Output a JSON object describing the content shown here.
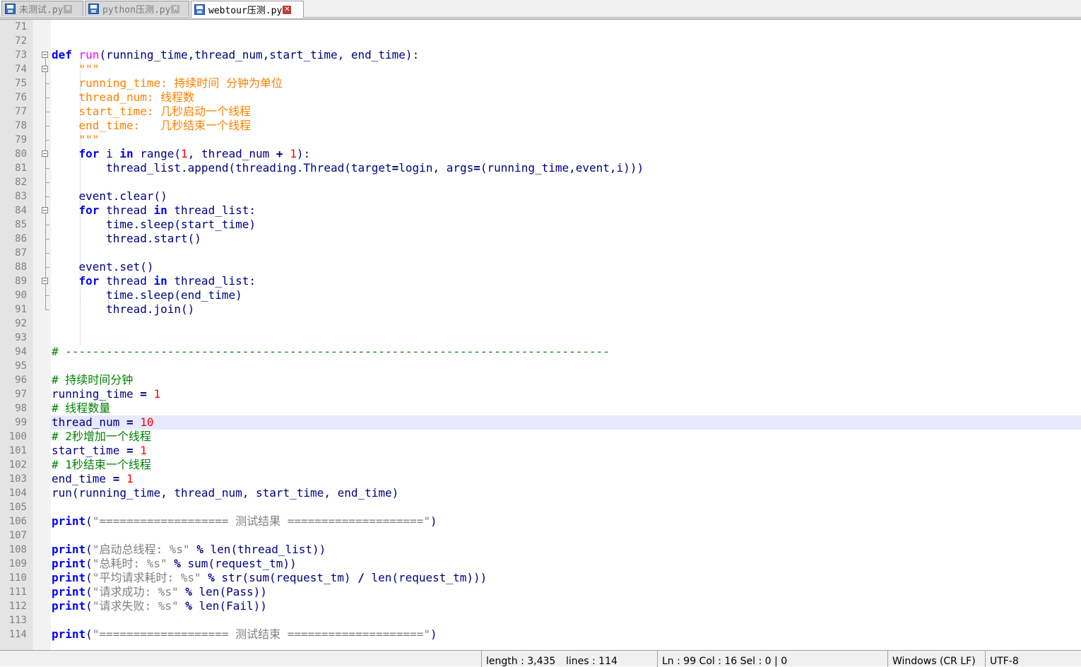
{
  "tabs": [
    {
      "label": "未测试.py",
      "active": false
    },
    {
      "label": "python压测.py",
      "active": false
    },
    {
      "label": "webtour压测.py",
      "active": true
    }
  ],
  "editor": {
    "current_line": 99,
    "lines": [
      {
        "n": "71",
        "segs": []
      },
      {
        "n": "72",
        "segs": []
      },
      {
        "n": "73",
        "segs": [
          [
            "kw",
            "def"
          ],
          [
            "p",
            " "
          ],
          [
            "fn",
            "run"
          ],
          [
            "p",
            "(running_time,thread_num,start_time, end_time):"
          ]
        ]
      },
      {
        "n": "74",
        "segs": [
          [
            "doc",
            "    \"\"\""
          ]
        ]
      },
      {
        "n": "75",
        "segs": [
          [
            "doc",
            "    running_time: 持续时间 分钟为单位"
          ]
        ]
      },
      {
        "n": "76",
        "segs": [
          [
            "doc",
            "    thread_num: 线程数"
          ]
        ]
      },
      {
        "n": "77",
        "segs": [
          [
            "doc",
            "    start_time: 几秒启动一个线程"
          ]
        ]
      },
      {
        "n": "78",
        "segs": [
          [
            "doc",
            "    end_time:   几秒结束一个线程"
          ]
        ]
      },
      {
        "n": "79",
        "segs": [
          [
            "doc",
            "    \"\"\""
          ]
        ]
      },
      {
        "n": "80",
        "segs": [
          [
            "p",
            "    "
          ],
          [
            "kw",
            "for"
          ],
          [
            "p",
            " i "
          ],
          [
            "kw",
            "in"
          ],
          [
            "p",
            " range("
          ],
          [
            "num",
            "1"
          ],
          [
            "p",
            ", thread_num "
          ],
          [
            "op",
            "+"
          ],
          [
            "p",
            " "
          ],
          [
            "num",
            "1"
          ],
          [
            "p",
            "):"
          ]
        ]
      },
      {
        "n": "81",
        "segs": [
          [
            "p",
            "        thread_list.append(threading.Thread(target"
          ],
          [
            "op",
            "="
          ],
          [
            "p",
            "login, args"
          ],
          [
            "op",
            "="
          ],
          [
            "p",
            "(running_time,event,i)))"
          ]
        ]
      },
      {
        "n": "82",
        "segs": []
      },
      {
        "n": "83",
        "segs": [
          [
            "p",
            "    event.clear()"
          ]
        ]
      },
      {
        "n": "84",
        "segs": [
          [
            "p",
            "    "
          ],
          [
            "kw",
            "for"
          ],
          [
            "p",
            " thread "
          ],
          [
            "kw",
            "in"
          ],
          [
            "p",
            " thread_list:"
          ]
        ]
      },
      {
        "n": "85",
        "segs": [
          [
            "p",
            "        time.sleep(start_time)"
          ]
        ]
      },
      {
        "n": "86",
        "segs": [
          [
            "p",
            "        thread.start()"
          ]
        ]
      },
      {
        "n": "87",
        "segs": []
      },
      {
        "n": "88",
        "segs": [
          [
            "p",
            "    event.set()"
          ]
        ]
      },
      {
        "n": "89",
        "segs": [
          [
            "p",
            "    "
          ],
          [
            "kw",
            "for"
          ],
          [
            "p",
            " thread "
          ],
          [
            "kw",
            "in"
          ],
          [
            "p",
            " thread_list:"
          ]
        ]
      },
      {
        "n": "90",
        "segs": [
          [
            "p",
            "        time.sleep(end_time)"
          ]
        ]
      },
      {
        "n": "91",
        "segs": [
          [
            "p",
            "        thread.join()"
          ]
        ]
      },
      {
        "n": "92",
        "segs": []
      },
      {
        "n": "93",
        "segs": []
      },
      {
        "n": "94",
        "segs": [
          [
            "cmt",
            "# --------------------------------------------------------------------------------"
          ]
        ]
      },
      {
        "n": "95",
        "segs": []
      },
      {
        "n": "96",
        "segs": [
          [
            "cmt",
            "# 持续时间分钟"
          ]
        ]
      },
      {
        "n": "97",
        "segs": [
          [
            "p",
            "running_time "
          ],
          [
            "op",
            "="
          ],
          [
            "p",
            " "
          ],
          [
            "num",
            "1"
          ]
        ]
      },
      {
        "n": "98",
        "segs": [
          [
            "cmt",
            "# 线程数量"
          ]
        ]
      },
      {
        "n": "99",
        "segs": [
          [
            "p",
            "thread_num "
          ],
          [
            "op",
            "="
          ],
          [
            "p",
            " "
          ],
          [
            "num",
            "10"
          ]
        ]
      },
      {
        "n": "100",
        "segs": [
          [
            "cmt",
            "# 2秒增加一个线程"
          ]
        ]
      },
      {
        "n": "101",
        "segs": [
          [
            "p",
            "start_time "
          ],
          [
            "op",
            "="
          ],
          [
            "p",
            " "
          ],
          [
            "num",
            "1"
          ]
        ]
      },
      {
        "n": "102",
        "segs": [
          [
            "cmt",
            "# 1秒结束一个线程"
          ]
        ]
      },
      {
        "n": "103",
        "segs": [
          [
            "p",
            "end_time "
          ],
          [
            "op",
            "="
          ],
          [
            "p",
            " "
          ],
          [
            "num",
            "1"
          ]
        ]
      },
      {
        "n": "104",
        "segs": [
          [
            "p",
            "run(running_time, thread_num, start_time, end_time)"
          ]
        ]
      },
      {
        "n": "105",
        "segs": []
      },
      {
        "n": "106",
        "segs": [
          [
            "kw",
            "print"
          ],
          [
            "p",
            "("
          ],
          [
            "str",
            "\"=================== 测试结果 ====================\""
          ],
          [
            "p",
            ")"
          ]
        ]
      },
      {
        "n": "107",
        "segs": []
      },
      {
        "n": "108",
        "segs": [
          [
            "kw",
            "print"
          ],
          [
            "p",
            "("
          ],
          [
            "str",
            "\"启动总线程: %s\""
          ],
          [
            "p",
            " "
          ],
          [
            "op",
            "%"
          ],
          [
            "p",
            " len(thread_list))"
          ]
        ]
      },
      {
        "n": "109",
        "segs": [
          [
            "kw",
            "print"
          ],
          [
            "p",
            "("
          ],
          [
            "str",
            "\"总耗时: %s\""
          ],
          [
            "p",
            " "
          ],
          [
            "op",
            "%"
          ],
          [
            "p",
            " sum(request_tm))"
          ]
        ]
      },
      {
        "n": "110",
        "segs": [
          [
            "kw",
            "print"
          ],
          [
            "p",
            "("
          ],
          [
            "str",
            "\"平均请求耗时: %s\""
          ],
          [
            "p",
            " "
          ],
          [
            "op",
            "%"
          ],
          [
            "p",
            " str(sum(request_tm) "
          ],
          [
            "op",
            "/"
          ],
          [
            "p",
            " len(request_tm)))"
          ]
        ]
      },
      {
        "n": "111",
        "segs": [
          [
            "kw",
            "print"
          ],
          [
            "p",
            "("
          ],
          [
            "str",
            "\"请求成功: %s\""
          ],
          [
            "p",
            " "
          ],
          [
            "op",
            "%"
          ],
          [
            "p",
            " len(Pass))"
          ]
        ]
      },
      {
        "n": "112",
        "segs": [
          [
            "kw",
            "print"
          ],
          [
            "p",
            "("
          ],
          [
            "str",
            "\"请求失败: %s\""
          ],
          [
            "p",
            " "
          ],
          [
            "op",
            "%"
          ],
          [
            "p",
            " len(Fail))"
          ]
        ]
      },
      {
        "n": "113",
        "segs": []
      },
      {
        "n": "114",
        "segs": [
          [
            "kw",
            "print"
          ],
          [
            "p",
            "("
          ],
          [
            "str",
            "\"=================== 测试结束 ====================\""
          ],
          [
            "p",
            ")"
          ]
        ]
      }
    ]
  },
  "statusbar": {
    "length": "length : 3,435",
    "lines": "lines : 114",
    "position": "Ln : 99    Col : 16    Sel : 0 | 0",
    "eol": "Windows (CR LF)",
    "encoding": "UTF-8"
  },
  "colors": {
    "keyword": "#0000ff",
    "function": "#ff00ff",
    "number": "#ff0000",
    "string": "#808080",
    "docstring": "#ff8000",
    "comment": "#008000",
    "default": "#000080",
    "current_line": "#e8e8ff"
  },
  "icons": {
    "tab_file": "floppy-save-icon",
    "tab_close": "close-x-icon"
  }
}
